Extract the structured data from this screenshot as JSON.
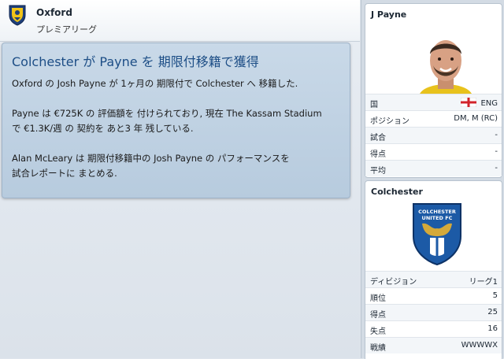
{
  "header": {
    "club_name": "Oxford",
    "league_name": "プレミアリーグ"
  },
  "news": {
    "title": "Colchester が Payne を 期限付移籍で獲得",
    "paragraphs": [
      [
        "Oxford の Josh Payne が 1ヶ月の 期限付で Colchester へ 移籍した."
      ],
      [
        "Payne は €725K の 評価額を 付けられており, 現在 The Kassam Stadium",
        "で €1.3K/週 の 契約を あと3 年 残している."
      ],
      [
        "Alan McLeary は 期限付移籍中の Josh Payne の パフォーマンスを",
        "試合レポートに まとめる."
      ]
    ]
  },
  "player_panel": {
    "title": "J Payne",
    "rows": [
      {
        "label": "国",
        "value": "ENG"
      },
      {
        "label": "ポジション",
        "value": "DM, M (RC)"
      },
      {
        "label": "試合",
        "value": "-"
      },
      {
        "label": "得点",
        "value": "-"
      },
      {
        "label": "平均",
        "value": "-"
      }
    ]
  },
  "club_panel": {
    "title": "Colchester",
    "badge_text": [
      "COLCHESTER",
      "UNITED FC"
    ],
    "rows": [
      {
        "label": "ディビジョン",
        "value": "リーグ1"
      },
      {
        "label": "順位",
        "value": "5"
      },
      {
        "label": "得点",
        "value": "25"
      },
      {
        "label": "失点",
        "value": "16"
      },
      {
        "label": "戦績",
        "value": "WWWWX"
      }
    ]
  },
  "colors": {
    "title_blue": "#1d4e86",
    "card_bg": "#c9d9e8",
    "sidebar_bg": "#d3dbe4"
  }
}
